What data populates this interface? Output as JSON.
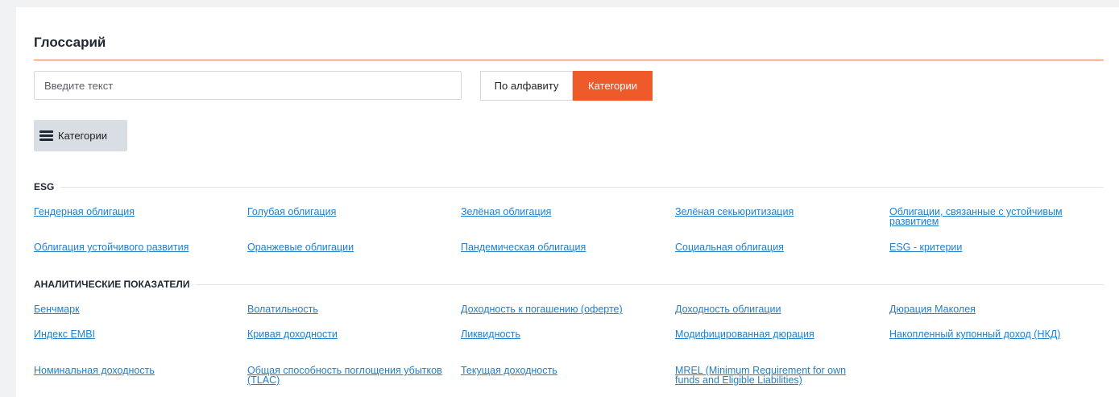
{
  "page": {
    "title": "Глоссарий"
  },
  "search": {
    "placeholder": "Введите текст",
    "value": ""
  },
  "toggle": {
    "alphabet_label": "По алфавиту",
    "categories_label": "Категории",
    "active": "categories"
  },
  "categories_menu": {
    "label": "Категории",
    "icon": "hamburger-menu-icon"
  },
  "colors": {
    "accent": "#ee5a2a",
    "link": "#1f7fcf",
    "rule": "#e87a5a",
    "menu_bg": "#d9dee5"
  },
  "sections": [
    {
      "name": "ESG",
      "terms": [
        "Гендерная облигация",
        "Голубая облигация",
        "Зелёная облигация",
        "Зелёная секьюритизация",
        "Облигации, связанные с устойчивым развитием",
        "Облигация устойчивого развития",
        "Оранжевые облигации",
        "Пандемическая облигация",
        "Социальная облигация",
        "ESG - критерии"
      ]
    },
    {
      "name": "АНАЛИТИЧЕСКИЕ ПОКАЗАТЕЛИ",
      "terms": [
        "Бенчмарк",
        "Волатильность",
        "Доходность к погашению (оферте)",
        "Доходность облигации",
        "Дюрация Маколея",
        "Индекс EMBI",
        "Кривая доходности",
        "Ликвидность",
        "Модифицированная дюрация",
        "Накопленный купонный доход (НКД)",
        "Номинальная доходность",
        "Общая способность поглощения убытков (TLAC)",
        "Текущая доходность",
        "MREL (Minimum Requirement for own funds and Eligible Liabilities)"
      ]
    }
  ]
}
